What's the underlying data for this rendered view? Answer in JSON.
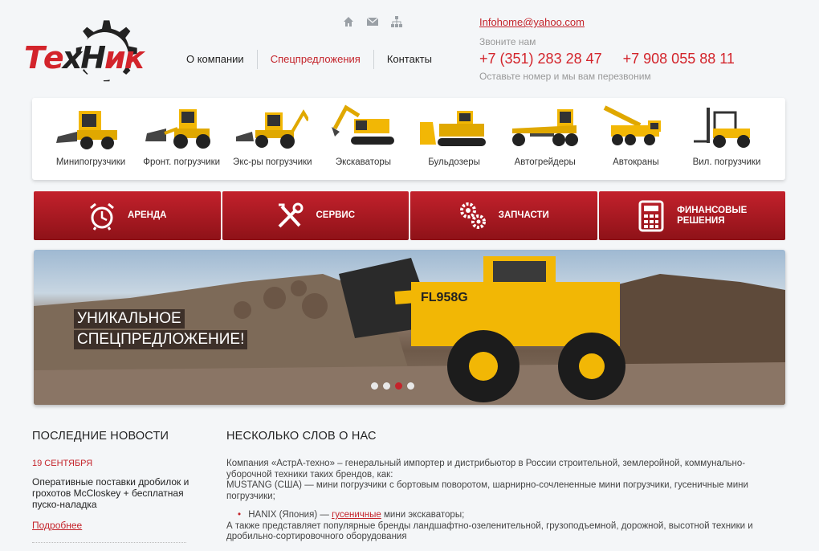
{
  "logo": {
    "p1": "Те",
    "p2": "хН",
    "p3": "ик"
  },
  "topicons": [
    "home-icon",
    "mail-icon",
    "sitemap-icon"
  ],
  "nav": [
    {
      "label": "О компании",
      "active": false
    },
    {
      "label": "Спецпредложения",
      "active": true
    },
    {
      "label": "Контакты",
      "active": false
    }
  ],
  "contacts": {
    "email": "Infohome@yahoo.com",
    "call_us": "Звоните нам",
    "phone1": "+7 (351) 283 28 47",
    "phone2": "+7 908 055 88 11",
    "callback": "Оставьте номер и мы вам перезвоним"
  },
  "categories": [
    {
      "label": "Минипогрузчики",
      "icon": "skid-steer-icon"
    },
    {
      "label": "Фронт. погрузчики",
      "icon": "front-loader-icon"
    },
    {
      "label": "Экс-ры погрузчики",
      "icon": "backhoe-icon"
    },
    {
      "label": "Экскаваторы",
      "icon": "excavator-icon"
    },
    {
      "label": "Бульдозеры",
      "icon": "bulldozer-icon"
    },
    {
      "label": "Автогрейдеры",
      "icon": "grader-icon"
    },
    {
      "label": "Автокраны",
      "icon": "crane-icon"
    },
    {
      "label": "Вил. погрузчики",
      "icon": "forklift-icon"
    }
  ],
  "services": [
    {
      "label": "Аренда",
      "icon": "alarm-clock-icon"
    },
    {
      "label": "Сервис",
      "icon": "tools-icon"
    },
    {
      "label": "Запчасти",
      "icon": "gears-icon"
    },
    {
      "label1": "Финансовые",
      "label2": "решения",
      "icon": "calculator-icon"
    }
  ],
  "slider": {
    "line1": "Уникальное",
    "line2": "спецпредложение!",
    "model": "FL958G",
    "dots": 4,
    "active_dot": 3
  },
  "news": {
    "title": "Последние новости",
    "date": "19 сентября",
    "text": "Оперативные поставки дробилок и грохотов McCloskey + бесплатная пуско-наладка",
    "more": "Подробнее"
  },
  "about": {
    "title": "Несколько слов о нас",
    "p1": "Компания «АстрА-техно» – генеральный импортер и дистрибьютор в России строительной, землеройной, коммунально-уборочной техники таких брендов, как:",
    "p2": "MUSTANG (США) — мини погрузчики с бортовым поворотом, шарнирно-сочлененные мини погрузчики, гусеничные мини погрузчики;",
    "li_prefix": "HANIX (Япония) — ",
    "li_link": "гусеничные",
    "li_suffix": " мини экскаваторы;",
    "p3": "А также представляет популярные бренды ландшафтно-озеленительной, грузоподъемной, дорожной, высотной техники и дробильно-сортировочного оборудования"
  },
  "colors": {
    "brand_red": "#c4242b",
    "machine_yellow": "#f2b705"
  }
}
